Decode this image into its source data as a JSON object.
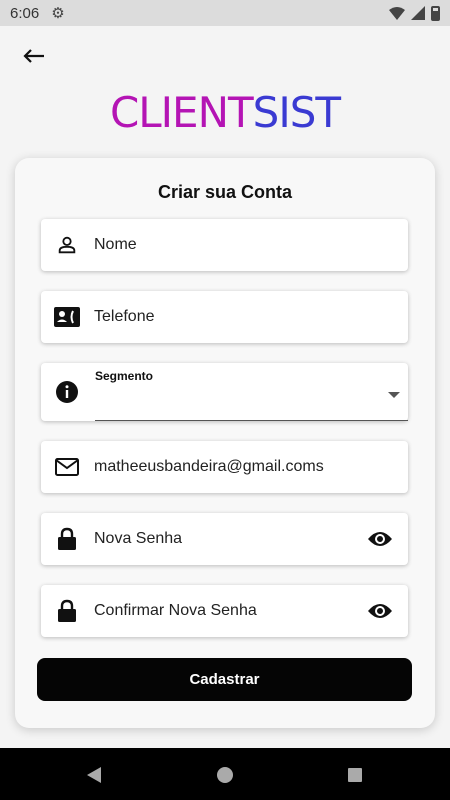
{
  "status_bar": {
    "time": "6:06"
  },
  "logo": {
    "part1": "CLIENT",
    "part2": "SIST"
  },
  "form": {
    "title": "Criar sua Conta",
    "fields": [
      {
        "label": "Nome",
        "icon": "person-icon"
      },
      {
        "label": "Telefone",
        "icon": "contact-card-icon"
      },
      {
        "label": "Segmento",
        "icon": "info-icon",
        "value": ""
      },
      {
        "label": "matheeusbandeira@gmail.coms",
        "icon": "mail-icon"
      },
      {
        "label": "Nova Senha",
        "icon": "lock-icon"
      },
      {
        "label": "Confirmar Nova Senha",
        "icon": "lock-icon"
      }
    ],
    "submit_label": "Cadastrar"
  },
  "colors": {
    "logo_part1": "#b414b4",
    "logo_part2": "#3a3ad2",
    "button": "#050505"
  }
}
